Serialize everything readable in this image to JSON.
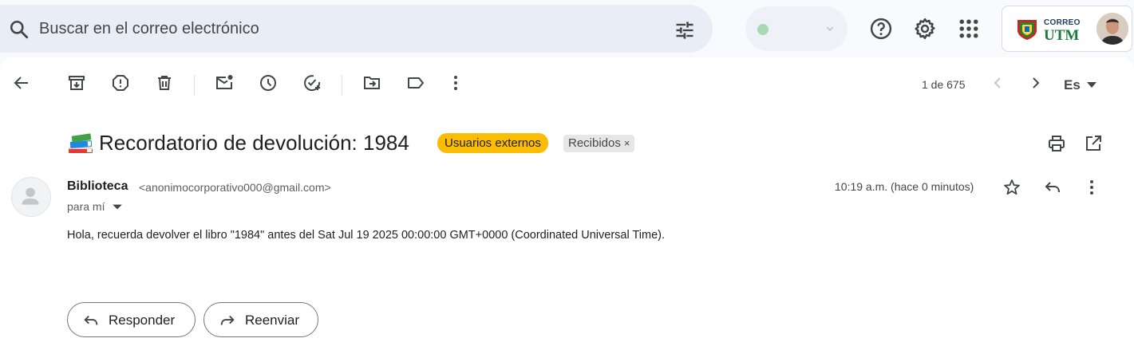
{
  "search": {
    "placeholder": "Buscar en el correo electrónico"
  },
  "account": {
    "brand_small": "CORREO",
    "brand_big": "UTM"
  },
  "toolbar": {
    "counter": "1 de 675",
    "language": "Es"
  },
  "message": {
    "subject": "Recordatorio de devolución: 1984",
    "labels": {
      "external": "Usuarios externos",
      "inbox": "Recibidos",
      "inbox_remove": "×"
    },
    "sender_name": "Biblioteca",
    "sender_email": "<anonimocorporativo000@gmail.com>",
    "to": "para mí",
    "time": "10:19 a.m. (hace 0 minutos)",
    "body": "Hola, recuerda devolver el libro \"1984\" antes del Sat Jul 19 2025 00:00:00 GMT+0000 (Coordinated Universal Time)."
  },
  "actions": {
    "reply": "Responder",
    "forward": "Reenviar"
  },
  "colors": {
    "external_chip": "#fbbc04",
    "search_bg": "#e9eef6",
    "status_dot": "#a8d8b4"
  }
}
